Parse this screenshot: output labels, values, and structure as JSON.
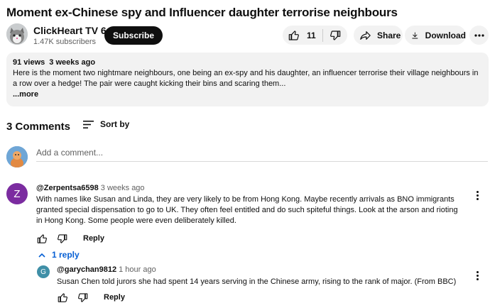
{
  "video": {
    "title": "Moment ex-Chinese spy and Influencer daughter terrorise neighbours",
    "channel_name": "ClickHeart TV 6",
    "subscribers": "1.47K subscribers",
    "subscribe_label": "Subscribe",
    "like_count": "11",
    "share_label": "Share",
    "download_label": "Download"
  },
  "description": {
    "views": "91 views",
    "age": "3 weeks ago",
    "text": "Here is the moment two nightmare neighbours, one being an ex-spy and his daughter, an influencer terrorise their village neighbours in a row over a hedge! The pair were caught kicking their bins and scaring them...",
    "more_label": "...more"
  },
  "comments_section": {
    "count_label": "3 Comments",
    "sort_label": "Sort by",
    "add_placeholder": "Add a comment..."
  },
  "comments": [
    {
      "avatar_letter": "Z",
      "avatar_color": "#7b2ca0",
      "author": "@Zerpentsa6598",
      "time": "3 weeks ago",
      "text": "With names like Susan and Linda, they are very likely to be from Hong Kong. Maybe recently arrivals as BNO immigrants granted special dispensation to go to UK. They often feel entitled and do such spiteful things. Look at the arson and rioting in Hong Kong. Some people were even deliberately killed.",
      "reply_label": "Reply",
      "replies_toggle": "1 reply",
      "replies": [
        {
          "avatar_letter": "G",
          "avatar_color": "#3f8fa7",
          "author": "@garychan9812",
          "time": "1 hour ago",
          "text": "Susan Chen told jurors she had spent 14 years serving in the Chinese army, rising to the rank of major. (From BBC)",
          "reply_label": "Reply"
        }
      ]
    }
  ],
  "colors": {
    "accent_blue": "#065fd4",
    "pill_bg": "#f2f2f2",
    "subscribe_bg": "#0f0f0f"
  },
  "icons": [
    "like-icon",
    "dislike-icon",
    "share-icon",
    "download-icon",
    "more-horiz-icon",
    "sort-icon",
    "more-vert-icon",
    "chevron-up-icon"
  ]
}
